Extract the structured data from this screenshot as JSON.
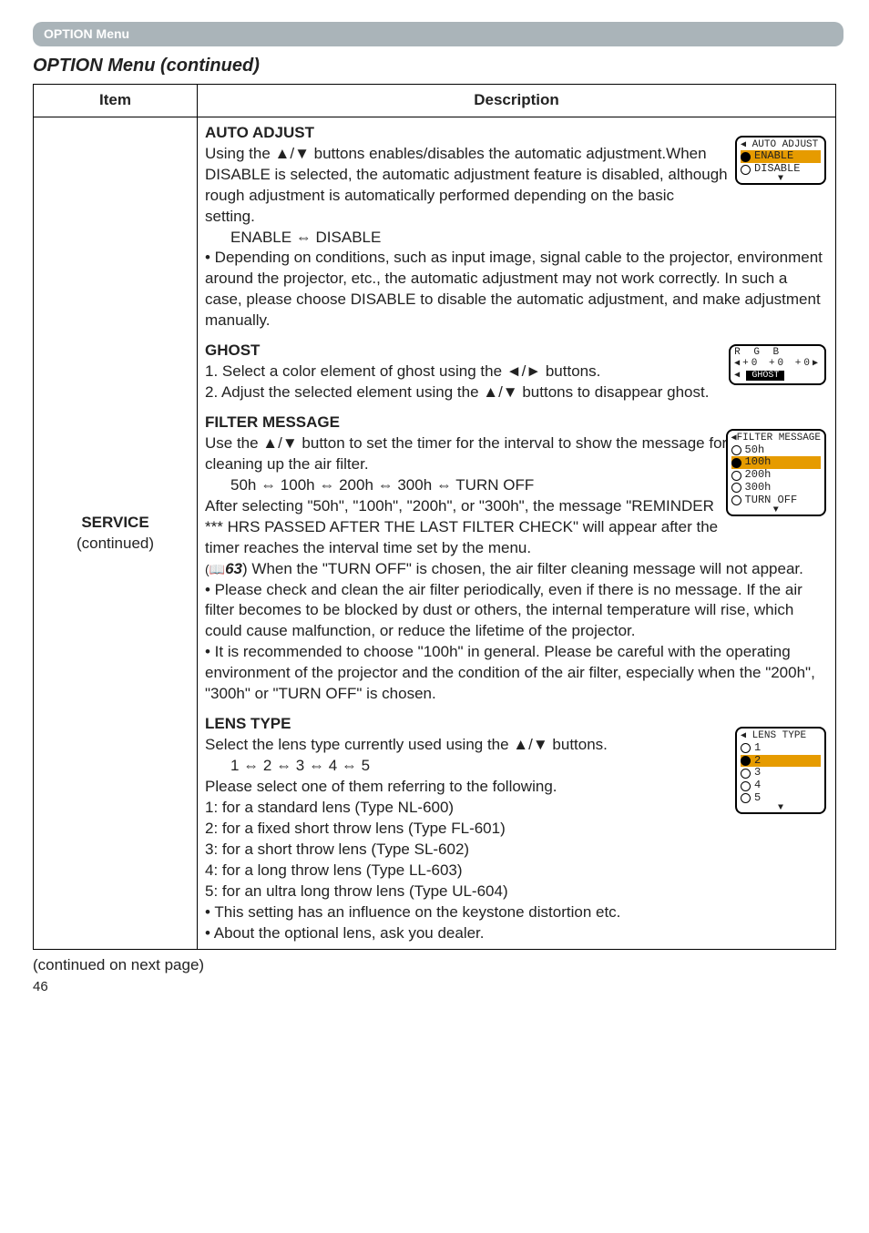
{
  "tab": "OPTION Menu",
  "section_title": "OPTION Menu (continued)",
  "table": {
    "headers": {
      "item": "Item",
      "description": "Description"
    },
    "item_cell": {
      "line1": "SERVICE",
      "line2": "(continued)"
    }
  },
  "auto_adjust": {
    "heading": "AUTO ADJUST",
    "p1": "Using the ▲/▼ buttons enables/disables the automatic adjustment.When DISABLE is selected, the automatic adjustment feature is disabled, although rough adjustment is automatically performed depending on the basic setting.",
    "toggle": "ENABLE ⇔ DISABLE",
    "p2": "• Depending on conditions, such as input image, signal cable to the projector, environment around the projector, etc., the automatic adjustment may not work correctly.  In such a case, please choose DISABLE to disable the automatic adjustment, and make adjustment manually.",
    "panel": {
      "title": "AUTO ADJUST",
      "opt1": "ENABLE",
      "opt2": "DISABLE"
    }
  },
  "ghost": {
    "heading": "GHOST",
    "step1": "1. Select a color element of ghost using the ◄/► buttons.",
    "step2": "2. Adjust the selected element using the ▲/▼ buttons to disappear ghost.",
    "panel": {
      "rgb": "R G B",
      "vals": "+0 +0 +0",
      "label": "GHOST"
    }
  },
  "filter_message": {
    "heading": "FILTER MESSAGE",
    "p1": "Use the ▲/▼ button to set the timer for the interval to show the message for cleaning up the air filter.",
    "sequence": "50h ⇔ 100h ⇔ 200h ⇔ 300h ⇔ TURN OFF",
    "p2a": "After selecting \"50h\", \"100h\", \"200h\", or \"300h\", the message \"REMINDER *** HRS PASSED AFTER THE LAST FILTER CHECK\" will appear after the timer reaches the interval time set by the menu.",
    "ref_prefix": "(📖",
    "ref_num": "63",
    "p2b": ") When the \"TURN OFF\" is chosen, the air filter cleaning message will not appear.",
    "p3": "• Please check and clean the air filter periodically, even if there is no message. If the air filter becomes to be blocked by dust or others, the internal temperature will rise, which could cause malfunction, or reduce the lifetime of the projector.",
    "p4": "• It is recommended to choose \"100h\" in general. Please be careful with the operating environment of the projector and the condition of the air filter, especially when the \"200h\", \"300h\" or \"TURN OFF\" is chosen.",
    "panel": {
      "title": "FILTER MESSAGE",
      "opts": [
        "50h",
        "100h",
        "200h",
        "300h",
        "TURN OFF"
      ],
      "selected": 1
    }
  },
  "lens_type": {
    "heading": "LENS TYPE",
    "p1": "Select the lens type currently used using the ▲/▼ buttons.",
    "sequence": "1 ⇔ 2 ⇔ 3 ⇔ 4 ⇔ 5",
    "p2": "Please select one of them referring to the following.",
    "l1": "1: for a standard lens (Type NL-600)",
    "l2": "2: for a fixed short throw lens (Type FL-601)",
    "l3": "3: for a short throw lens (Type SL-602)",
    "l4": "4: for a long throw lens (Type LL-603)",
    "l5": "5: for an ultra long throw lens (Type UL-604)",
    "p3": "• This setting has an influence on the keystone distortion etc.",
    "p4": "• About the optional lens, ask you dealer.",
    "panel": {
      "title": "LENS TYPE",
      "opts": [
        "1",
        "2",
        "3",
        "4",
        "5"
      ],
      "selected": 1
    }
  },
  "footer": {
    "continued": "(continued on next page)",
    "page": "46"
  }
}
